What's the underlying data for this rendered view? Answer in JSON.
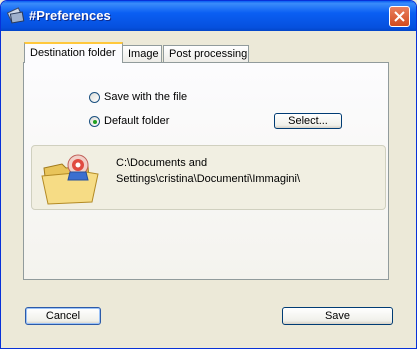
{
  "window": {
    "title": "#Preferences"
  },
  "tabs": [
    {
      "label": "Destination folder"
    },
    {
      "label": "Image"
    },
    {
      "label": "Post processing"
    }
  ],
  "destination": {
    "option_save_with_file": "Save with the file",
    "option_default_folder": "Default folder",
    "selected_option": "Default folder",
    "select_button": "Select...",
    "folder_path": "C:\\Documents and Settings\\cristina\\Documenti\\Immagini\\"
  },
  "footer": {
    "cancel_label": "Cancel",
    "save_label": "Save"
  },
  "colors": {
    "titlebar": "#0a5ff3",
    "active_tab_accent": "#ffc83c",
    "radio_dot": "#21a121"
  }
}
